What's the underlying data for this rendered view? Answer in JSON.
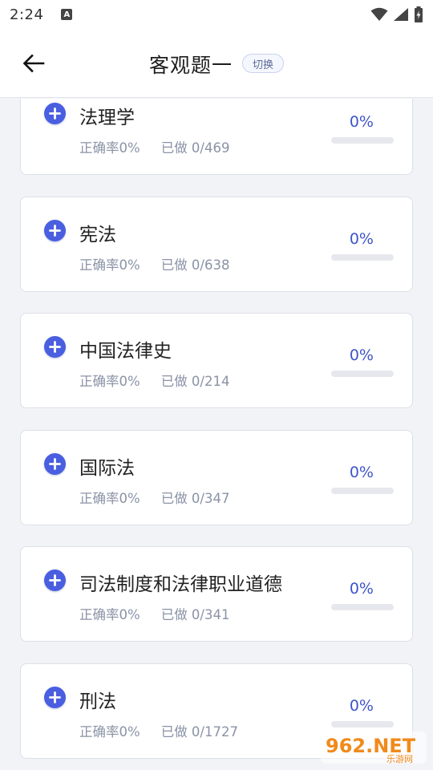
{
  "status_bar": {
    "time": "2:24",
    "notification_icon": "a-badge-icon",
    "icons": [
      "wifi-icon",
      "signal-icon",
      "battery-icon"
    ]
  },
  "header": {
    "title": "客观题一",
    "switch_label": "切换",
    "back_icon": "arrow-left-icon"
  },
  "subjects": [
    {
      "name": "法理学",
      "accuracy": "正确率0%",
      "done": "已做 0/469",
      "progress": "0%",
      "progress_value": 0
    },
    {
      "name": "宪法",
      "accuracy": "正确率0%",
      "done": "已做 0/638",
      "progress": "0%",
      "progress_value": 0
    },
    {
      "name": "中国法律史",
      "accuracy": "正确率0%",
      "done": "已做 0/214",
      "progress": "0%",
      "progress_value": 0
    },
    {
      "name": "国际法",
      "accuracy": "正确率0%",
      "done": "已做 0/347",
      "progress": "0%",
      "progress_value": 0
    },
    {
      "name": "司法制度和法律职业道德",
      "accuracy": "正确率0%",
      "done": "已做 0/341",
      "progress": "0%",
      "progress_value": 0
    },
    {
      "name": "刑法",
      "accuracy": "正确率0%",
      "done": "已做 0/1727",
      "progress": "0%",
      "progress_value": 0
    }
  ],
  "watermark": {
    "text": "962.NET",
    "subtext": "乐游网"
  },
  "colors": {
    "accent": "#4a5ee0",
    "percent_text": "#3f55c8",
    "meta_text": "#8a93a6",
    "background": "#f2f3f7"
  }
}
